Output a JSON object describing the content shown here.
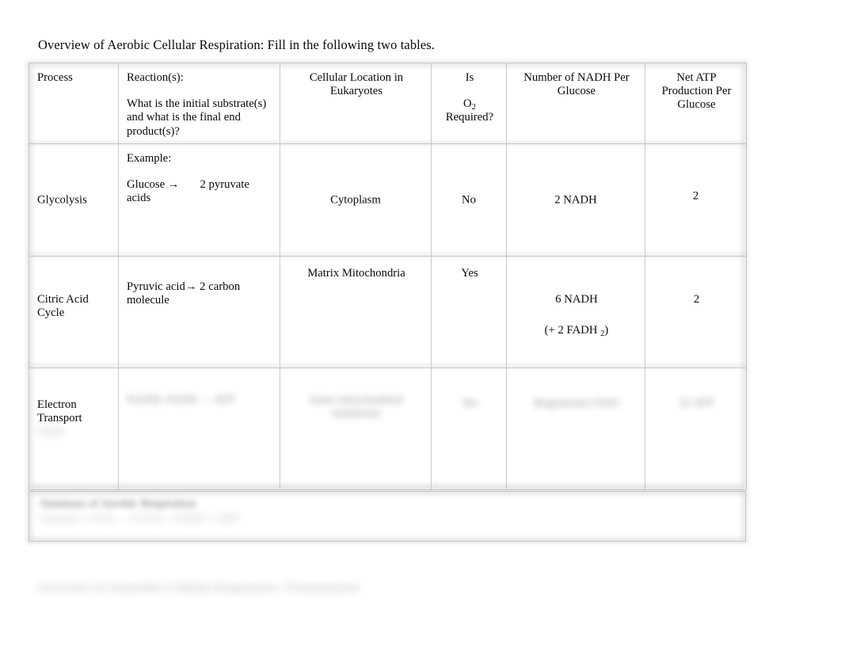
{
  "document": {
    "title": "Overview of Aerobic Cellular Respiration: Fill in the following two tables."
  },
  "table": {
    "headers": {
      "process": "Process",
      "reaction_line1": "Reaction(s):",
      "reaction_line2": "What is the initial substrate(s) and what is the final end product(s)?",
      "location_line1": "Cellular Location in",
      "location_line2": "Eukaryotes",
      "oxygen_line1": "Is",
      "oxygen_line2_pre": "O",
      "oxygen_line2_sub": "2",
      "oxygen_line3": "Required?",
      "nadh_line1": "Number of NADH Per",
      "nadh_line2": "Glucose",
      "atp_line1": "Net ATP",
      "atp_line2": "Production Per",
      "atp_line3": "Glucose"
    },
    "rows": [
      {
        "process": "Glycolysis",
        "reaction_label": "Example:",
        "reaction_left": "Glucose →",
        "reaction_right": "2 pyruvate acids",
        "location": "Cytoplasm",
        "oxygen": "No",
        "nadh": "2 NADH",
        "nadh_extra": "",
        "atp": "2"
      },
      {
        "process_line1": "Citric Acid",
        "process_line2": "Cycle",
        "reaction": "Pyruvic acid→ 2 carbon molecule",
        "location": "Matrix Mitochondria",
        "oxygen": "Yes",
        "nadh": "6 NADH",
        "nadh_extra_pre": "(+ 2 FADH ",
        "nadh_extra_sub": "2",
        "nadh_extra_post": ")",
        "atp": "2"
      },
      {
        "process_line1": "Electron",
        "process_line2": "Transport",
        "process_line3_obscured": "Chain",
        "reaction_obscured": "NADH, FADH → ATP",
        "location_obscured": "Inner mitochondrial membrane",
        "oxygen_obscured": "Yes",
        "nadh_obscured": "Regenerates NAD",
        "atp_obscured": "32 ATP"
      }
    ]
  },
  "bottom_box": {
    "line1_obscured": "Summary of Aerobic Respiration:",
    "line2_obscured": "Glucose + 6 O2 → 6 CO2 + 6 H2O + ATP"
  },
  "footer": {
    "line_obscured": "Overview of Anaerobic Cellular Respiration / Fermentation"
  }
}
